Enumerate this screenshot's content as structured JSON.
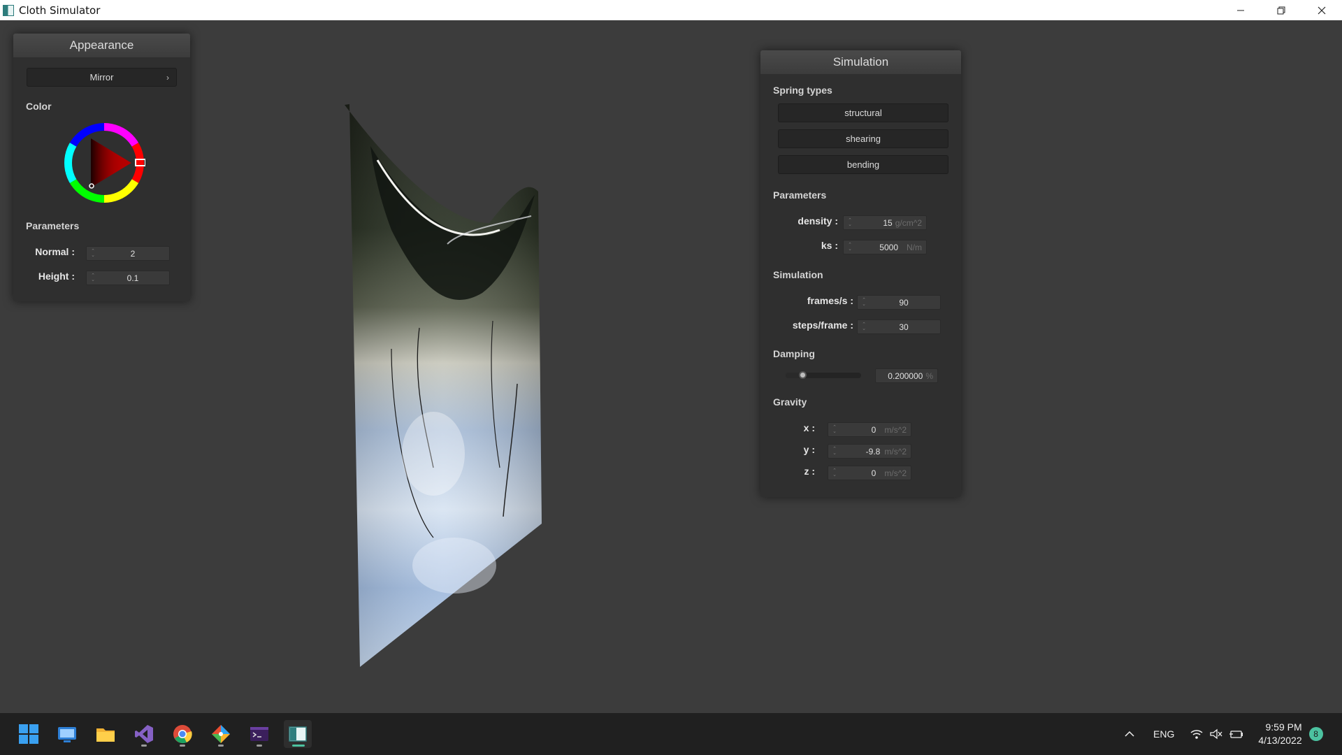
{
  "window": {
    "title": "Cloth Simulator"
  },
  "appearance": {
    "title": "Appearance",
    "material": "Mirror",
    "color_label": "Color",
    "color_hue": "#ff0000",
    "params_label": "Parameters",
    "normal": {
      "label": "Normal :",
      "value": "2"
    },
    "height": {
      "label": "Height :",
      "value": "0.1"
    }
  },
  "simulation": {
    "title": "Simulation",
    "spring_types_label": "Spring types",
    "spring_buttons": [
      "structural",
      "shearing",
      "bending"
    ],
    "parameters_label": "Parameters",
    "density": {
      "label": "density :",
      "value": "15",
      "unit": "g/cm^2"
    },
    "ks": {
      "label": "ks :",
      "value": "5000",
      "unit": "N/m"
    },
    "simulation_label": "Simulation",
    "fps": {
      "label": "frames/s :",
      "value": "90"
    },
    "steps": {
      "label": "steps/frame :",
      "value": "30"
    },
    "damping_label": "Damping",
    "damping": {
      "value": "0.200000",
      "unit": "%",
      "level": 0.2
    },
    "gravity_label": "Gravity",
    "gravity": [
      {
        "label": "x :",
        "value": "0",
        "unit": "m/s^2"
      },
      {
        "label": "y :",
        "value": "-9.8",
        "unit": "m/s^2"
      },
      {
        "label": "z :",
        "value": "0",
        "unit": "m/s^2"
      }
    ]
  },
  "taskbar": {
    "language": "ENG",
    "time": "9:59 PM",
    "date": "4/13/2022",
    "notification_count": "8",
    "apps": [
      "start-icon",
      "remote-desktop-icon",
      "file-explorer-icon",
      "visual-studio-icon",
      "chrome-icon",
      "git-icon",
      "terminal-icon",
      "cloth-simulator-icon"
    ]
  }
}
